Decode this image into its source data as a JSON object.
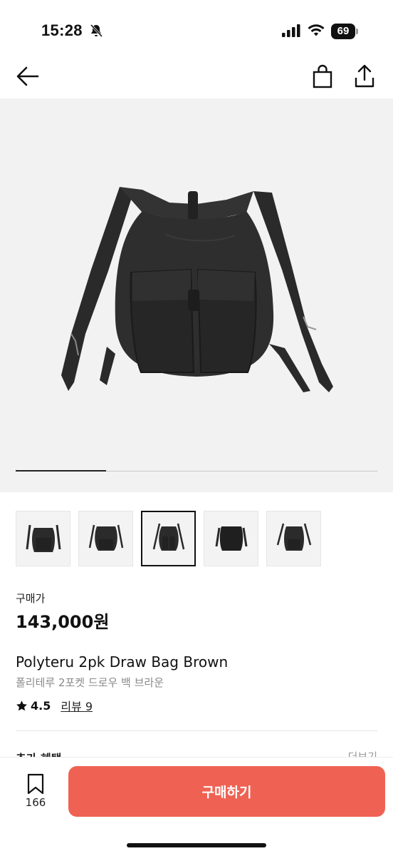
{
  "status_bar": {
    "time": "15:28",
    "battery": "69",
    "icons": [
      "bell-off-icon",
      "signal-icon",
      "wifi-icon",
      "battery-icon"
    ]
  },
  "nav": {
    "icons": [
      "back-arrow-icon",
      "shopping-bag-icon",
      "share-icon"
    ]
  },
  "gallery": {
    "progress": 0.25,
    "thumbnail_count": 5,
    "selected_index": 2
  },
  "product": {
    "price_label": "구매가",
    "price": "143,000원",
    "name_en": "Polyteru 2pk Draw Bag Brown",
    "name_ko": "폴리테루 2포켓 드로우 백 브라운",
    "rating": "4.5",
    "review_text": "리뷰 9"
  },
  "benefits": {
    "title": "추가 혜택",
    "more": "더보기"
  },
  "bottom_bar": {
    "wish_count": "166",
    "buy_label": "구매하기"
  },
  "colors": {
    "accent": "#ef6253",
    "background": "#f2f2f2",
    "text": "#111111"
  }
}
